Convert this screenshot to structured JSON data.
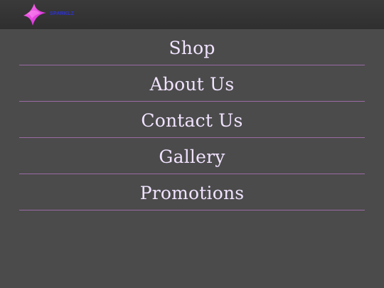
{
  "header": {
    "brand_text": "SPARKLZ",
    "logo_icon": "sparkle-logo-icon",
    "colors": {
      "bar": "#313131",
      "brand_text": "#2c31d6",
      "logo_pink": "#ff4bd8"
    }
  },
  "menu": {
    "items": [
      {
        "label": "Shop"
      },
      {
        "label": "About Us"
      },
      {
        "label": "Contact Us"
      },
      {
        "label": "Gallery"
      },
      {
        "label": "Promotions"
      }
    ],
    "colors": {
      "background": "#4b4b4b",
      "text": "#f0e3ff",
      "divider": "#9a6aa3"
    }
  }
}
